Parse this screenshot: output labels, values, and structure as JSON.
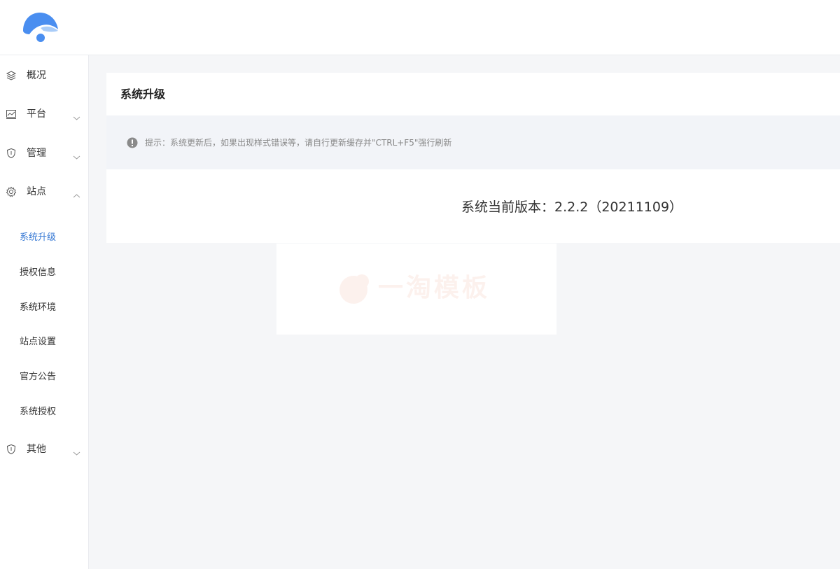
{
  "brand": {
    "logo_icon": "cloud-logo-icon",
    "logo_color": "#4a8ef0"
  },
  "sidebar": {
    "items": [
      {
        "label": "概况",
        "icon": "layers-icon",
        "arrow": ""
      },
      {
        "label": "平台",
        "icon": "chart-icon",
        "arrow": "chevron-down-icon"
      },
      {
        "label": "管理",
        "icon": "shield-icon",
        "arrow": "chevron-down-icon"
      },
      {
        "label": "站点",
        "icon": "gear-icon",
        "arrow": "chevron-up-icon"
      },
      {
        "label": "其他",
        "icon": "shield-icon",
        "arrow": "chevron-down-icon"
      }
    ],
    "sub_items": [
      {
        "label": "系统升级",
        "active": true
      },
      {
        "label": "授权信息",
        "active": false
      },
      {
        "label": "系统环境",
        "active": false
      },
      {
        "label": "站点设置",
        "active": false
      },
      {
        "label": "官方公告",
        "active": false
      },
      {
        "label": "系统授权",
        "active": false
      }
    ],
    "active_color": "#3a7bd5"
  },
  "main": {
    "title": "系统升级",
    "notice": "提示：系统更新后，如果出现样式错误等，请自行更新缓存并\"CTRL+F5\"强行刷新",
    "notice_icon": "exclamation-circle-icon",
    "version_text": "系统当前版本：2.2.2（20211109）"
  },
  "watermark": {
    "text": "一淘模板",
    "color": "#e3572e"
  }
}
